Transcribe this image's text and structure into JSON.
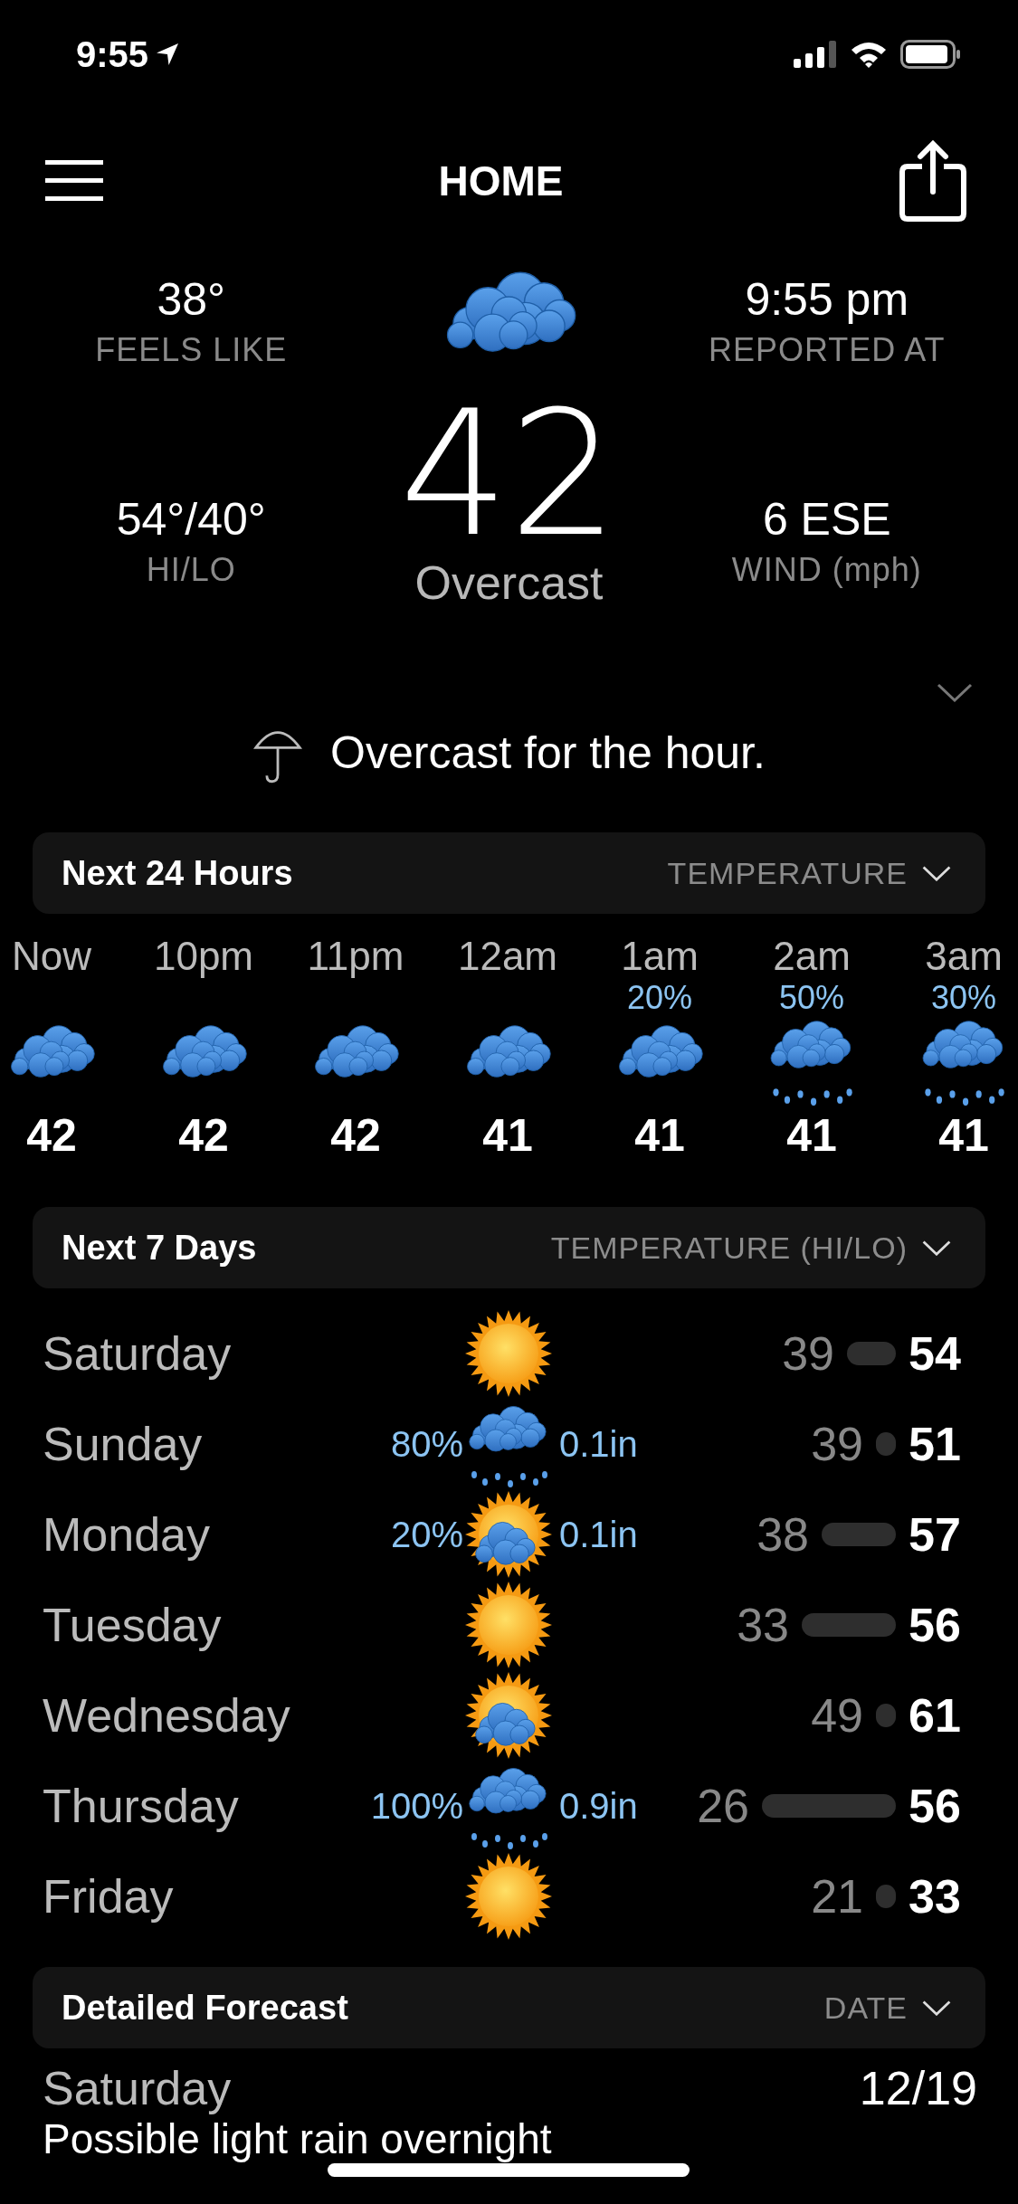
{
  "status_bar": {
    "time": "9:55"
  },
  "header": {
    "title": "HOME"
  },
  "current": {
    "feels_like": {
      "value": "38°",
      "label": "FEELS LIKE"
    },
    "reported": {
      "value": "9:55 pm",
      "label": "REPORTED AT"
    },
    "hilo": {
      "value": "54°/40°",
      "label": "HI/LO"
    },
    "wind": {
      "value": "6 ESE",
      "label": "WIND (mph)"
    },
    "kind": "cloudy",
    "temperature": "42",
    "condition": "Overcast"
  },
  "summary": {
    "text": "Overcast for the hour.",
    "expanded": false
  },
  "next_24_hours": {
    "title": "Next 24 Hours",
    "selector": "TEMPERATURE",
    "hours": [
      {
        "time": "Now",
        "kind": "cloudy",
        "temp": "42"
      },
      {
        "time": "10pm",
        "kind": "cloudy",
        "temp": "42"
      },
      {
        "time": "11pm",
        "kind": "cloudy",
        "temp": "42"
      },
      {
        "time": "12am",
        "kind": "cloudy",
        "temp": "41"
      },
      {
        "time": "1am",
        "precip": "20%",
        "kind": "cloudy",
        "temp": "41"
      },
      {
        "time": "2am",
        "precip": "50%",
        "kind": "rain",
        "temp": "41"
      },
      {
        "time": "3am",
        "precip": "30%",
        "kind": "rain",
        "temp": "41"
      }
    ]
  },
  "next_7_days": {
    "title": "Next 7 Days",
    "selector": "TEMPERATURE (HI/LO)",
    "days": [
      {
        "day": "Saturday",
        "kind": "sunny",
        "lo": "39",
        "hi": "54"
      },
      {
        "day": "Sunday",
        "precip": "80%",
        "kind": "rain",
        "amount": "0.1in",
        "lo": "39",
        "hi": "51"
      },
      {
        "day": "Monday",
        "precip": "20%",
        "kind": "partly_cloudy",
        "amount": "0.1in",
        "lo": "38",
        "hi": "57"
      },
      {
        "day": "Tuesday",
        "kind": "sunny",
        "lo": "33",
        "hi": "56"
      },
      {
        "day": "Wednesday",
        "kind": "partly_cloudy",
        "lo": "49",
        "hi": "61"
      },
      {
        "day": "Thursday",
        "precip": "100%",
        "kind": "rain",
        "amount": "0.9in",
        "lo": "26",
        "hi": "56"
      },
      {
        "day": "Friday",
        "kind": "sunny",
        "lo": "21",
        "hi": "33"
      }
    ]
  },
  "detailed_forecast": {
    "title": "Detailed Forecast",
    "selector": "DATE",
    "entries": [
      {
        "day": "Saturday",
        "date": "12/19",
        "text": "Possible light rain overnight"
      }
    ]
  }
}
